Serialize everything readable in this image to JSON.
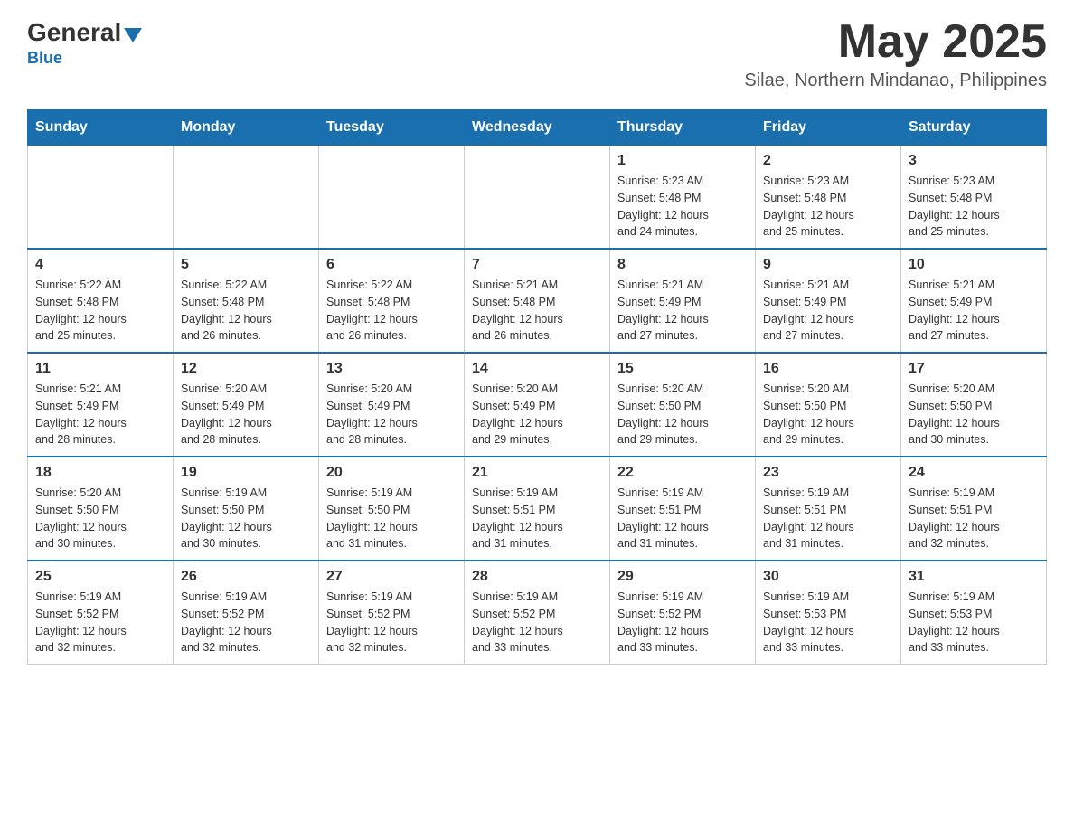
{
  "header": {
    "logo_general": "General",
    "logo_blue": "Blue",
    "month_year": "May 2025",
    "location": "Silae, Northern Mindanao, Philippines"
  },
  "weekdays": [
    "Sunday",
    "Monday",
    "Tuesday",
    "Wednesday",
    "Thursday",
    "Friday",
    "Saturday"
  ],
  "weeks": [
    [
      {
        "day": "",
        "info": ""
      },
      {
        "day": "",
        "info": ""
      },
      {
        "day": "",
        "info": ""
      },
      {
        "day": "",
        "info": ""
      },
      {
        "day": "1",
        "info": "Sunrise: 5:23 AM\nSunset: 5:48 PM\nDaylight: 12 hours\nand 24 minutes."
      },
      {
        "day": "2",
        "info": "Sunrise: 5:23 AM\nSunset: 5:48 PM\nDaylight: 12 hours\nand 25 minutes."
      },
      {
        "day": "3",
        "info": "Sunrise: 5:23 AM\nSunset: 5:48 PM\nDaylight: 12 hours\nand 25 minutes."
      }
    ],
    [
      {
        "day": "4",
        "info": "Sunrise: 5:22 AM\nSunset: 5:48 PM\nDaylight: 12 hours\nand 25 minutes."
      },
      {
        "day": "5",
        "info": "Sunrise: 5:22 AM\nSunset: 5:48 PM\nDaylight: 12 hours\nand 26 minutes."
      },
      {
        "day": "6",
        "info": "Sunrise: 5:22 AM\nSunset: 5:48 PM\nDaylight: 12 hours\nand 26 minutes."
      },
      {
        "day": "7",
        "info": "Sunrise: 5:21 AM\nSunset: 5:48 PM\nDaylight: 12 hours\nand 26 minutes."
      },
      {
        "day": "8",
        "info": "Sunrise: 5:21 AM\nSunset: 5:49 PM\nDaylight: 12 hours\nand 27 minutes."
      },
      {
        "day": "9",
        "info": "Sunrise: 5:21 AM\nSunset: 5:49 PM\nDaylight: 12 hours\nand 27 minutes."
      },
      {
        "day": "10",
        "info": "Sunrise: 5:21 AM\nSunset: 5:49 PM\nDaylight: 12 hours\nand 27 minutes."
      }
    ],
    [
      {
        "day": "11",
        "info": "Sunrise: 5:21 AM\nSunset: 5:49 PM\nDaylight: 12 hours\nand 28 minutes."
      },
      {
        "day": "12",
        "info": "Sunrise: 5:20 AM\nSunset: 5:49 PM\nDaylight: 12 hours\nand 28 minutes."
      },
      {
        "day": "13",
        "info": "Sunrise: 5:20 AM\nSunset: 5:49 PM\nDaylight: 12 hours\nand 28 minutes."
      },
      {
        "day": "14",
        "info": "Sunrise: 5:20 AM\nSunset: 5:49 PM\nDaylight: 12 hours\nand 29 minutes."
      },
      {
        "day": "15",
        "info": "Sunrise: 5:20 AM\nSunset: 5:50 PM\nDaylight: 12 hours\nand 29 minutes."
      },
      {
        "day": "16",
        "info": "Sunrise: 5:20 AM\nSunset: 5:50 PM\nDaylight: 12 hours\nand 29 minutes."
      },
      {
        "day": "17",
        "info": "Sunrise: 5:20 AM\nSunset: 5:50 PM\nDaylight: 12 hours\nand 30 minutes."
      }
    ],
    [
      {
        "day": "18",
        "info": "Sunrise: 5:20 AM\nSunset: 5:50 PM\nDaylight: 12 hours\nand 30 minutes."
      },
      {
        "day": "19",
        "info": "Sunrise: 5:19 AM\nSunset: 5:50 PM\nDaylight: 12 hours\nand 30 minutes."
      },
      {
        "day": "20",
        "info": "Sunrise: 5:19 AM\nSunset: 5:50 PM\nDaylight: 12 hours\nand 31 minutes."
      },
      {
        "day": "21",
        "info": "Sunrise: 5:19 AM\nSunset: 5:51 PM\nDaylight: 12 hours\nand 31 minutes."
      },
      {
        "day": "22",
        "info": "Sunrise: 5:19 AM\nSunset: 5:51 PM\nDaylight: 12 hours\nand 31 minutes."
      },
      {
        "day": "23",
        "info": "Sunrise: 5:19 AM\nSunset: 5:51 PM\nDaylight: 12 hours\nand 31 minutes."
      },
      {
        "day": "24",
        "info": "Sunrise: 5:19 AM\nSunset: 5:51 PM\nDaylight: 12 hours\nand 32 minutes."
      }
    ],
    [
      {
        "day": "25",
        "info": "Sunrise: 5:19 AM\nSunset: 5:52 PM\nDaylight: 12 hours\nand 32 minutes."
      },
      {
        "day": "26",
        "info": "Sunrise: 5:19 AM\nSunset: 5:52 PM\nDaylight: 12 hours\nand 32 minutes."
      },
      {
        "day": "27",
        "info": "Sunrise: 5:19 AM\nSunset: 5:52 PM\nDaylight: 12 hours\nand 32 minutes."
      },
      {
        "day": "28",
        "info": "Sunrise: 5:19 AM\nSunset: 5:52 PM\nDaylight: 12 hours\nand 33 minutes."
      },
      {
        "day": "29",
        "info": "Sunrise: 5:19 AM\nSunset: 5:52 PM\nDaylight: 12 hours\nand 33 minutes."
      },
      {
        "day": "30",
        "info": "Sunrise: 5:19 AM\nSunset: 5:53 PM\nDaylight: 12 hours\nand 33 minutes."
      },
      {
        "day": "31",
        "info": "Sunrise: 5:19 AM\nSunset: 5:53 PM\nDaylight: 12 hours\nand 33 minutes."
      }
    ]
  ]
}
